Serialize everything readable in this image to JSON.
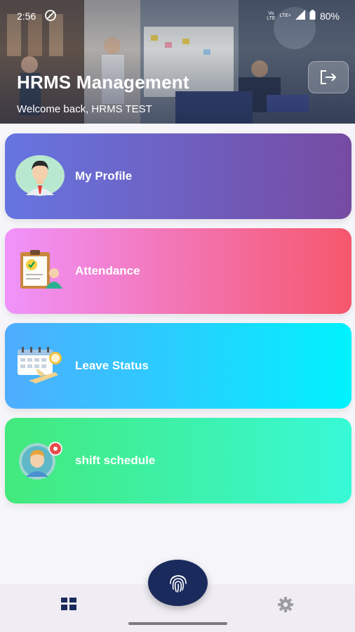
{
  "status_bar": {
    "time": "2:56",
    "network_top": "Vo",
    "network_bottom": "LTE",
    "lte_label": "LTE+",
    "battery": "80%"
  },
  "header": {
    "title": "HRMS Management",
    "welcome": "Welcome back, HRMS TEST"
  },
  "cards": [
    {
      "label": "My Profile",
      "icon": "user-avatar-icon"
    },
    {
      "label": "Attendance",
      "icon": "clipboard-checklist-icon"
    },
    {
      "label": "Leave Status",
      "icon": "calendar-plane-icon"
    },
    {
      "label": "shift schedule",
      "icon": "worker-gear-icon"
    }
  ],
  "bottom_nav": {
    "home_icon": "dashboard-grid-icon",
    "fab_icon": "fingerprint-icon",
    "settings_icon": "gear-icon"
  },
  "colors": {
    "profile_gradient": [
      "#6675e0",
      "#764ba2"
    ],
    "attendance_gradient": [
      "#f093fb",
      "#f5576c"
    ],
    "leave_gradient": [
      "#4facfe",
      "#00f2fe"
    ],
    "shift_gradient": [
      "#43e97b",
      "#38f9d7"
    ],
    "fab": "#1a2a5c"
  }
}
